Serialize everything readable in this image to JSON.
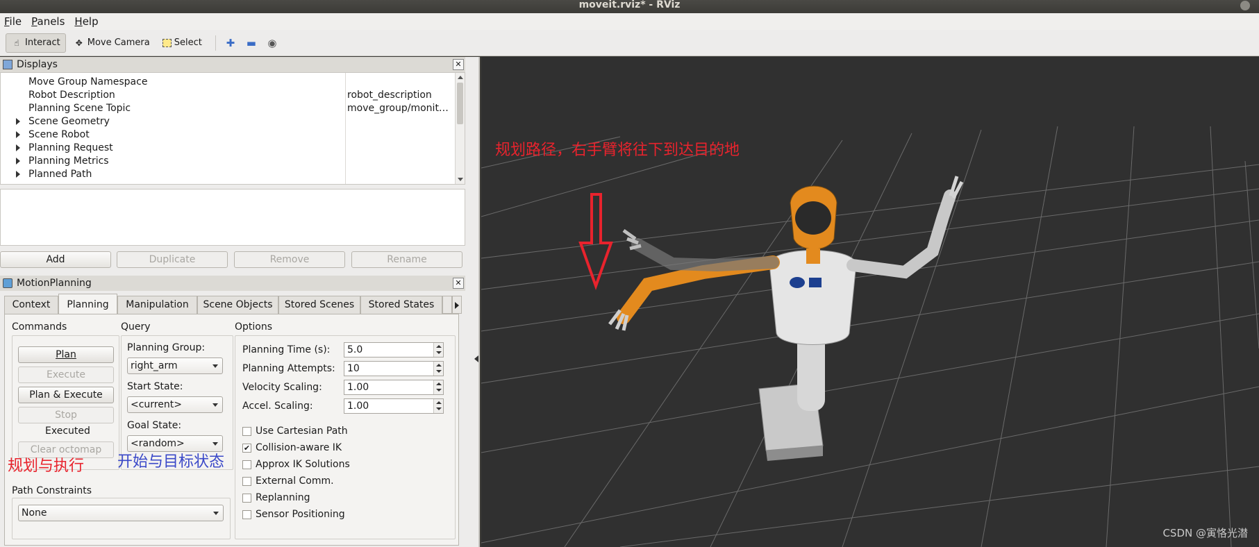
{
  "window": {
    "title": "moveit.rviz* - RViz"
  },
  "menu": {
    "items": [
      "File",
      "Panels",
      "Help"
    ]
  },
  "toolbar": {
    "interact": "Interact",
    "move_camera": "Move Camera",
    "select": "Select"
  },
  "displays": {
    "title": "Displays",
    "rows": [
      {
        "name": "Move Group Namespace",
        "value": "",
        "expandable": false
      },
      {
        "name": "Robot Description",
        "value": "robot_description",
        "expandable": false
      },
      {
        "name": "Planning Scene Topic",
        "value": "move_group/monit…",
        "expandable": false
      },
      {
        "name": "Scene Geometry",
        "value": "",
        "expandable": true
      },
      {
        "name": "Scene Robot",
        "value": "",
        "expandable": true
      },
      {
        "name": "Planning Request",
        "value": "",
        "expandable": true
      },
      {
        "name": "Planning Metrics",
        "value": "",
        "expandable": true
      },
      {
        "name": "Planned Path",
        "value": "",
        "expandable": true
      }
    ],
    "buttons": {
      "add": "Add",
      "duplicate": "Duplicate",
      "remove": "Remove",
      "rename": "Rename"
    }
  },
  "motion_planning": {
    "title": "MotionPlanning",
    "tabs": [
      "Context",
      "Planning",
      "Manipulation",
      "Scene Objects",
      "Stored Scenes",
      "Stored States"
    ],
    "active_tab": "Planning",
    "commands": {
      "label": "Commands",
      "plan": "Plan",
      "execute": "Execute",
      "plan_execute": "Plan & Execute",
      "stop": "Stop",
      "status": "Executed",
      "clear_octomap": "Clear octomap"
    },
    "query": {
      "label": "Query",
      "planning_group_label": "Planning Group:",
      "planning_group_value": "right_arm",
      "start_state_label": "Start State:",
      "start_state_value": "<current>",
      "goal_state_label": "Goal State:",
      "goal_state_value": "<random>"
    },
    "options": {
      "label": "Options",
      "planning_time_label": "Planning Time (s):",
      "planning_time": "5.0",
      "planning_attempts_label": "Planning Attempts:",
      "planning_attempts": "10",
      "velocity_scaling_label": "Velocity Scaling:",
      "velocity_scaling": "1.00",
      "accel_scaling_label": "Accel. Scaling:",
      "accel_scaling": "1.00",
      "checks": [
        {
          "label": "Use Cartesian Path",
          "checked": false
        },
        {
          "label": "Collision-aware IK",
          "checked": true
        },
        {
          "label": "Approx IK Solutions",
          "checked": false
        },
        {
          "label": "External Comm.",
          "checked": false
        },
        {
          "label": "Replanning",
          "checked": false
        },
        {
          "label": "Sensor Positioning",
          "checked": false
        }
      ]
    },
    "path_constraints": {
      "label": "Path Constraints",
      "value": "None"
    }
  },
  "annotations": {
    "plan_execute": "规划与执行",
    "start_goal": "开始与目标状态",
    "view_note": "规划路径，右手臂将往下到达目的地"
  },
  "watermark": "CSDN @寅恪光潜",
  "colors": {
    "annotation_red": "#e8232d",
    "annotation_blue": "#3a48c8",
    "robot_orange": "#e38a1e",
    "viewport_bg": "#303030"
  }
}
